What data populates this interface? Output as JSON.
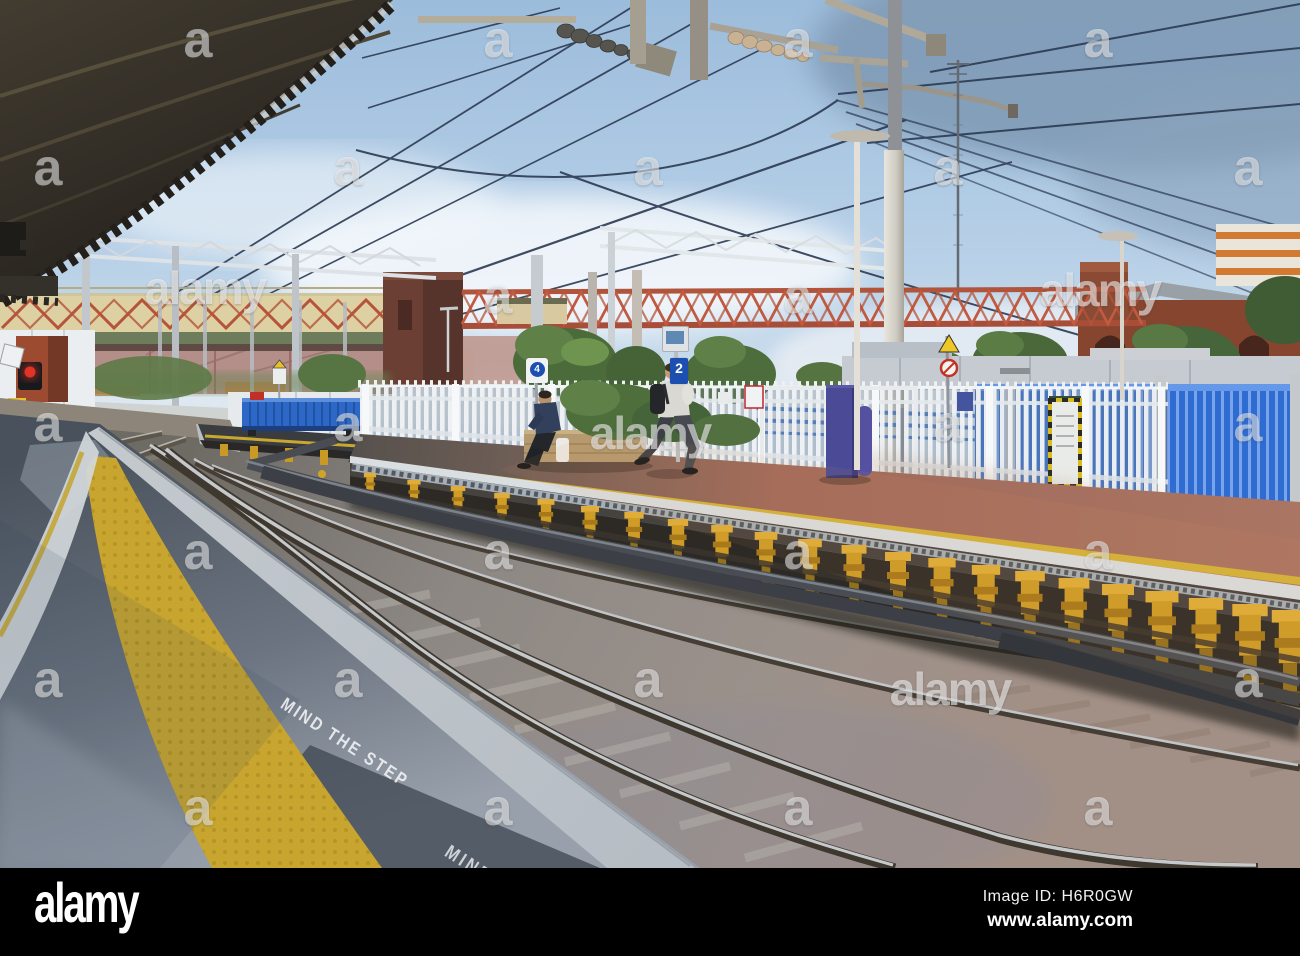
{
  "image": {
    "subject": "Railway station platform with overhead electric wires, footbridges and two passengers"
  },
  "signs": {
    "platform_number": "2",
    "track_marker": "4",
    "platform_marking": "MIND THE STEP",
    "platform_marking_partial": "MIND"
  },
  "watermark": {
    "letter": "a",
    "word": "alamy"
  },
  "footer": {
    "logo_text": "alamy",
    "image_id": "Image ID: H6R0GW",
    "website": "www.alamy.com"
  },
  "colors": {
    "sky": "#aac6e0",
    "canopy_dark": "#332e27",
    "bridge_cream": "#ddd0a2",
    "bridge_red": "#b5543a",
    "fence_white": "#eef1f4",
    "fence_blue": "#2e6cd2",
    "platform_paving": "#a06a5c",
    "support_yellow": "#cf9d26",
    "tactile_yellow": "#c7a52f",
    "asphalt": "#5a626c",
    "sign_blue": "#1c4fb0",
    "footer_background": "#000000"
  }
}
